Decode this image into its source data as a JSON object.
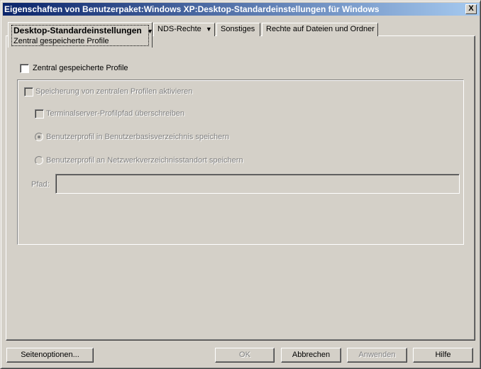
{
  "window": {
    "title": "Eigenschaften von Benutzerpaket:Windows XP:Desktop-Standardeinstellungen für Windows",
    "close": "X"
  },
  "tabs": [
    {
      "label": "Desktop-Standardeinstellungen",
      "sub": "Zentral gespeicherte Profile",
      "arrow": "▼"
    },
    {
      "label": "NDS-Rechte",
      "arrow": "▼"
    },
    {
      "label": "Sonstiges"
    },
    {
      "label": "Rechte auf Dateien und Ordner"
    }
  ],
  "form": {
    "central_profiles": {
      "label": "Zentral gespeicherte Profile",
      "checked": false
    },
    "activate": {
      "label": "Speicherung von zentralen Profilen aktivieren",
      "checked": false
    },
    "terminal": {
      "label": "Terminalserver-Profilpfad überschreiben",
      "checked": false
    },
    "radio_home": {
      "label": "Benutzerprofil in Benutzerbasisverzeichnis speichern",
      "selected": true
    },
    "radio_network": {
      "label": "Benutzerprofil an Netzwerkverzeichnisstandort speichern",
      "selected": false
    },
    "path": {
      "label": "Pfad:",
      "value": ""
    }
  },
  "buttons": {
    "page_options": "Seitenoptionen...",
    "ok": "OK",
    "cancel": "Abbrechen",
    "apply": "Anwenden",
    "help": "Hilfe"
  }
}
